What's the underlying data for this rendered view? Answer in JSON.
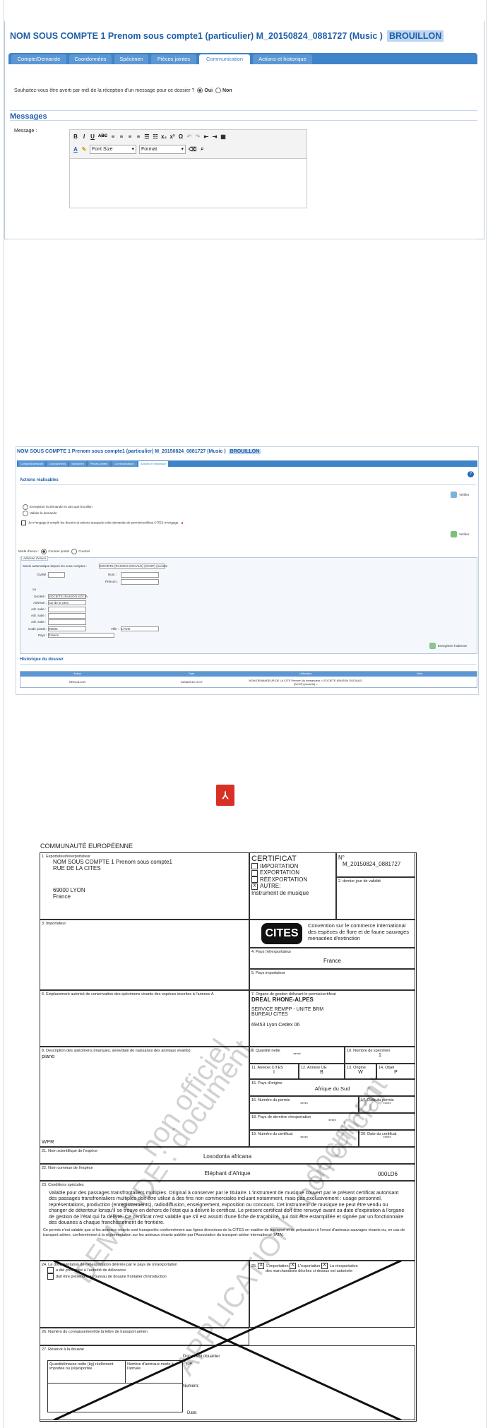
{
  "header": {
    "title": "NOM SOUS COMPTE 1 Prenom sous compte1 (particulier)   M_20150824_0881727 (Music )",
    "status": "BROUILLON"
  },
  "tabs": [
    "Compte/Demande",
    "Coordonnées",
    "Spécimen",
    "Pièces jointes",
    "Communication",
    "Actions et historique"
  ],
  "notify": {
    "question": "Souhaitez-vous être averti par mél de la réception d'un message pour ce dossier ?",
    "yes": "Oui",
    "no": "Non"
  },
  "messages": {
    "heading": "Messages",
    "label": "Message :",
    "toolbar": {
      "font_size": "Font Size",
      "format": "Format"
    }
  },
  "history_screen": {
    "title": "NOM SOUS COMPTE 1 Prenom sous compte1 (particulier)   M_20150824_0881727 (Music )",
    "status": "BROUILLON",
    "actions_heading": "Actions réalisables",
    "option1": "Enregistrer la demande en tant que brouillon",
    "option2": "Valider la demande",
    "commitment": "Je m'engage à remplir les devoirs et actions auxquels cette demande de permis/certificat CITES m'engage.",
    "verify": "Vérifier",
    "verify2": "Vérifier",
    "send_mode_label": "Mode d'envoi :",
    "send_post": "Courrier postal",
    "send_mail": "Courriel",
    "addr_tab": "Adresse d'envoi",
    "addr_auto": "Saisie automatique depuis les sous comptes :",
    "addr_auto_value": "SOCIETE (RAISON SOCIALE) (SCOP) (societe",
    "civ_label": "Civilité :",
    "nom_label": "Nom :",
    "prenom_label": "Prénom :",
    "ou_label": "ou",
    "soc_label": "Société :",
    "soc_value": "SOCIETE (RAISON SOCIA",
    "adresse_label": "Adresse :",
    "adresse_value": "rue de la cites",
    "adr1": "Adr. suite :",
    "adr2": "Adr. suite :",
    "adr3": "Adr. suite :",
    "cp_label": "Code postal :",
    "cp_value": "69000",
    "ville_label": "Ville :",
    "ville_value": "LYON",
    "pays_label": "Pays :",
    "pays_value": "France",
    "save_addr": "Enregistrer l'adresse",
    "history_heading": "Historique du dossier",
    "table_headers": [
      "Action",
      "Date",
      "Utilisateur",
      "Note"
    ],
    "table_row": [
      "BROUILLON",
      "24/08/2015 10:07",
      "NOM DEMANDEUR DE LA CITE Prenom du demandeur < SOCIETE (RAISON SOCIALE) (SCOP) (societe) >",
      ""
    ]
  },
  "certificate": {
    "community": "COMMUNAUTÉ EUROPÉENNE",
    "f1_label": "1. Exportateur/réexportateur",
    "exporter_name": "NOM SOUS COMPTE 1 Prenom sous compte1",
    "exporter_street": "RUE DE LA CITES",
    "exporter_city": "69000 LYON",
    "exporter_country": "France",
    "cert_title": "CERTIFICAT",
    "opt_import": "IMPORTATION",
    "opt_export": "EXPORTATION",
    "opt_reexport": "RÉEXPORTATION",
    "opt_other": "AUTRE:",
    "other_value": "Instrument de musique",
    "num_label": "N°",
    "num_value": "M_20150824_0881727",
    "f2_label": "2. dernier jour de validité",
    "f3_label": "3. Importateur",
    "cites_logo": "CITES",
    "cites_text": "Convention sur le commerce international des espèces de flore et de faune sauvages menacées d'extinction",
    "f4_label": "4. Pays (ré)exportateur",
    "f4_value": "France",
    "f5_label": "5. Pays importateur",
    "f6_label": "6. Emplacement autorisé de conservation des spécimens vivants des espèces inscrites à l'annexe A",
    "f7_label": "7. Organe de gestion délivrant le permis/certificat",
    "f7_l1": "DREAL RHONE-ALPES",
    "f7_l2": "SERVICE REMPP - UNITE BRM",
    "f7_l3": "BUREAU CITES",
    "f7_l4": "69453 Lyon Cedex 06",
    "f8_label": "8. Description des spécimens (marques, sexe/date de naissance des animaux vivants)",
    "f8_value": "piano",
    "f8_code": "WPR",
    "f9_label": "9. Quantité nette",
    "f9_value": "*****",
    "f10_label": "10. Nombre de spécimen",
    "f10_value": "1",
    "f11_label": "11. Annexe CITES",
    "f11_value": "I",
    "f12_label": "12. Annexe UE",
    "f12_value": "B",
    "f13_label": "13. Origine",
    "f13_value": "W",
    "f14_label": "14. Objet",
    "f14_value": "P",
    "f15_label": "15. Pays d'origine",
    "f15_value": "Afrique du Sud",
    "f16_label": "16. Numéro du permis",
    "f16_value": "*****",
    "f17_label": "17. Date du permis",
    "f17_value": "*****",
    "f18_label": "18. Pays de dernière réexportation",
    "f18_value": "*****",
    "f19_label": "19. Numéro du certificat",
    "f19_value": "*****",
    "f20_label": "20. Date du certificat",
    "f20_value": "*****",
    "f21_label": "21. Nom scientifique de l'espèce",
    "f21_value": "Loxodonta africana",
    "f22_label": "22. Nom commun de l'espèce",
    "f22_value": "Eléphant d'Afrique",
    "f22_code": "000LD6",
    "f23_label": "23. Conditions spéciales",
    "f23_text": "Valable pour des passages transfrontaliers multiples. Original à conserver par le titulaire. L'instrument de musique couvert par le présent certificat autorisant des passages transfrontaliers multiples doit être utilisé à des fins non commerciales incluant notamment, mais pas exclusivement : usage personnel, représentations, production (enregistrements), radiodiffusion, enseignement, exposition ou concours. Cet instrument de musique ne peut être vendu ou changer de détenteur lorsqu'il se trouve en dehors de l'état qui a délivré le certificat. Le présent certificat doit être renvoyé avant sa date d'expiration à l'organe de gestion de l'état qui l'a délivré. Ce certificat n'est valable que s'il est assorti d'une fiche de traçabilité, qui doit être estampillée et signée par un fonctionnaire des douanes à chaque franchissement de frontière.",
    "f23_text2": "Ce permis n'est valable que si les animaux vivants sont transportés conformément aux lignes directrices de la CITES en matière de transport et de préparation à l'envoi d'animaux sauvages vivants ou, en cas de transport aérien, conformément à la réglementation sur les animaux vivants publiée par l'Association du transport aérien international (IATA).",
    "f24_label": "24. La documentation de (ré)exportation délivrée par le pays de (ré)exportation",
    "f24_o1": "a été présentée à l'autorité de délivrance",
    "f24_o2": "doit être présentée au bureau de douane frontalier d'introduction",
    "f25_label": "25.",
    "f25_o1": "L'importation",
    "f25_o2": "L'exportation",
    "f25_o3": "La réexportation",
    "f25_text": "des marchandises décrites ci-dessus est autorisée",
    "f26_label": "26. Numéro du connaissement/de la lettre de transport aérien",
    "f27_label": "27. Réservé à la douane",
    "f27_c1": "Quantité/masse nette (kg) réellement importée ou (ré)exportée",
    "f27_c2": "Nombre d'animaux morts à l'arrivée",
    "f27_doc": "Document douanier",
    "f27_type": "Type:",
    "f27_num": "Numéro:",
    "f27_date": "Date:",
    "wm1": "DEMANDE : document",
    "wm2": "non officiel",
    "wm3": "APPLICATION : non official",
    "wm4": "document"
  }
}
